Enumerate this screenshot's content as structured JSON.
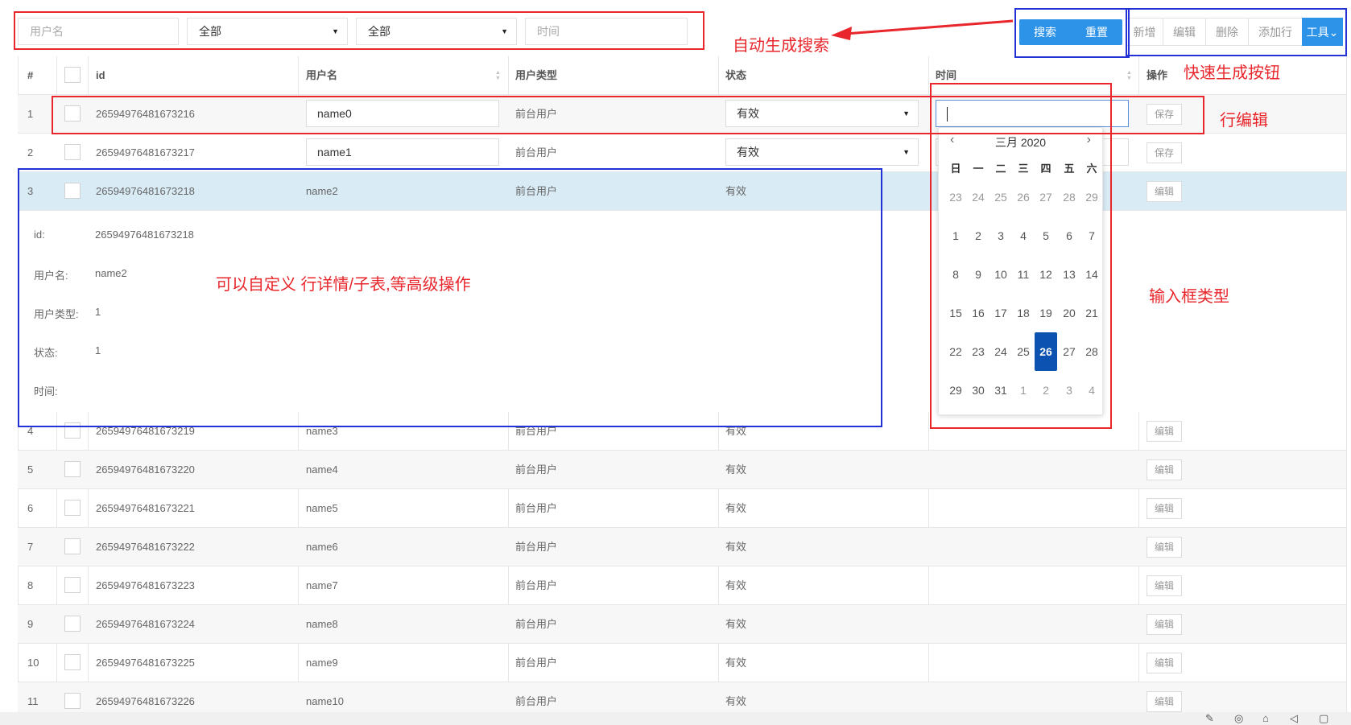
{
  "search": {
    "username_placeholder": "用户名",
    "select1_value": "全部",
    "select2_value": "全部",
    "time_placeholder": "时间",
    "search_label": "搜索",
    "reset_label": "重置"
  },
  "toolbar": {
    "add": "新增",
    "edit": "编辑",
    "delete": "删除",
    "add_row": "添加行",
    "tools": "工具"
  },
  "table": {
    "headers": [
      "#",
      "id",
      "用户名",
      "用户类型",
      "状态",
      "时间",
      "操作"
    ],
    "rows": [
      {
        "n": "1",
        "id": "26594976481673216",
        "name": "name0",
        "type": "前台用户",
        "status": "有效",
        "action": "保存"
      },
      {
        "n": "2",
        "id": "26594976481673217",
        "name": "name1",
        "type": "前台用户",
        "status": "有效",
        "action": "保存"
      },
      {
        "n": "3",
        "id": "26594976481673218",
        "name": "name2",
        "type": "前台用户",
        "status": "有效",
        "action": "编辑"
      },
      {
        "n": "4",
        "id": "26594976481673219",
        "name": "name3",
        "type": "前台用户",
        "status": "有效",
        "action": "编辑"
      },
      {
        "n": "5",
        "id": "26594976481673220",
        "name": "name4",
        "type": "前台用户",
        "status": "有效",
        "action": "编辑"
      },
      {
        "n": "6",
        "id": "26594976481673221",
        "name": "name5",
        "type": "前台用户",
        "status": "有效",
        "action": "编辑"
      },
      {
        "n": "7",
        "id": "26594976481673222",
        "name": "name6",
        "type": "前台用户",
        "status": "有效",
        "action": "编辑"
      },
      {
        "n": "8",
        "id": "26594976481673223",
        "name": "name7",
        "type": "前台用户",
        "status": "有效",
        "action": "编辑"
      },
      {
        "n": "9",
        "id": "26594976481673224",
        "name": "name8",
        "type": "前台用户",
        "status": "有效",
        "action": "编辑"
      },
      {
        "n": "10",
        "id": "26594976481673225",
        "name": "name9",
        "type": "前台用户",
        "status": "有效",
        "action": "编辑"
      },
      {
        "n": "11",
        "id": "26594976481673226",
        "name": "name10",
        "type": "前台用户",
        "status": "有效",
        "action": "编辑"
      }
    ]
  },
  "detail": {
    "labels": [
      "id:",
      "用户名:",
      "用户类型:",
      "状态:",
      "时间:"
    ],
    "values": [
      "26594976481673218",
      "name2",
      "1",
      "1",
      ""
    ]
  },
  "calendar": {
    "title": "三月 2020",
    "weekdays": [
      "日",
      "一",
      "二",
      "三",
      "四",
      "五",
      "六"
    ],
    "weeks": [
      [
        "23",
        "24",
        "25",
        "26",
        "27",
        "28",
        "29"
      ],
      [
        "1",
        "2",
        "3",
        "4",
        "5",
        "6",
        "7"
      ],
      [
        "8",
        "9",
        "10",
        "11",
        "12",
        "13",
        "14"
      ],
      [
        "15",
        "16",
        "17",
        "18",
        "19",
        "20",
        "21"
      ],
      [
        "22",
        "23",
        "24",
        "25",
        "26",
        "27",
        "28"
      ],
      [
        "29",
        "30",
        "31",
        "1",
        "2",
        "3",
        "4"
      ]
    ],
    "selected": "26"
  },
  "annotations": {
    "auto_search": "自动生成搜索",
    "quick_buttons": "快速生成按钮",
    "row_edit": "行编辑",
    "custom_detail": "可以自定义 行详情/子表,等高级操作",
    "input_types": "输入框类型"
  },
  "colors": {
    "accent": "#2c93e9",
    "annotation_red": "#e8262b",
    "annotation_blue": "#2332d6",
    "selected_day": "#0c52b0"
  }
}
